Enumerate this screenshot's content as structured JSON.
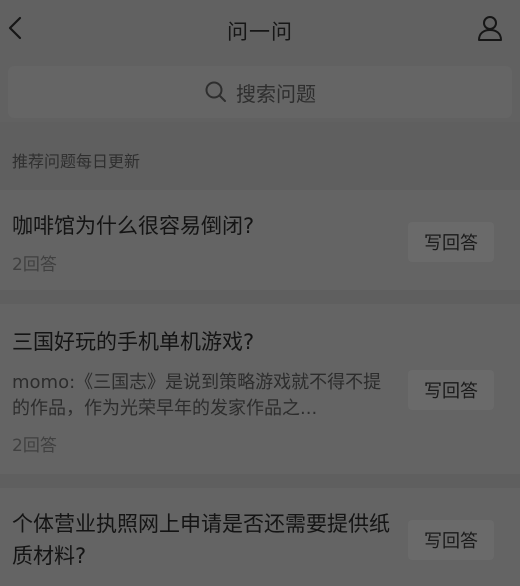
{
  "header": {
    "title": "问一问",
    "back_icon": "chevron-left-icon",
    "user_icon": "user-icon"
  },
  "search": {
    "icon": "search-icon",
    "placeholder": "搜索问题"
  },
  "section": {
    "label": "推荐问题每日更新"
  },
  "questions": [
    {
      "title": "咖啡馆为什么很容易倒闭?",
      "answer_count": "2回答",
      "action_label": "写回答"
    },
    {
      "title": "三国好玩的手机单机游戏?",
      "excerpt": "momo:《三国志》是说到策略游戏就不得不提的作品，作为光荣早年的发家作品之...",
      "answer_count": "2回答",
      "action_label": "写回答"
    },
    {
      "title": "个体营业执照网上申请是否还需要提供纸质材料?",
      "action_label": "写回答"
    }
  ],
  "colors": {
    "overlay_background": "#5f5f5f",
    "header_background": "#616161",
    "card_background": "#646464",
    "text_dark": "#141414"
  }
}
